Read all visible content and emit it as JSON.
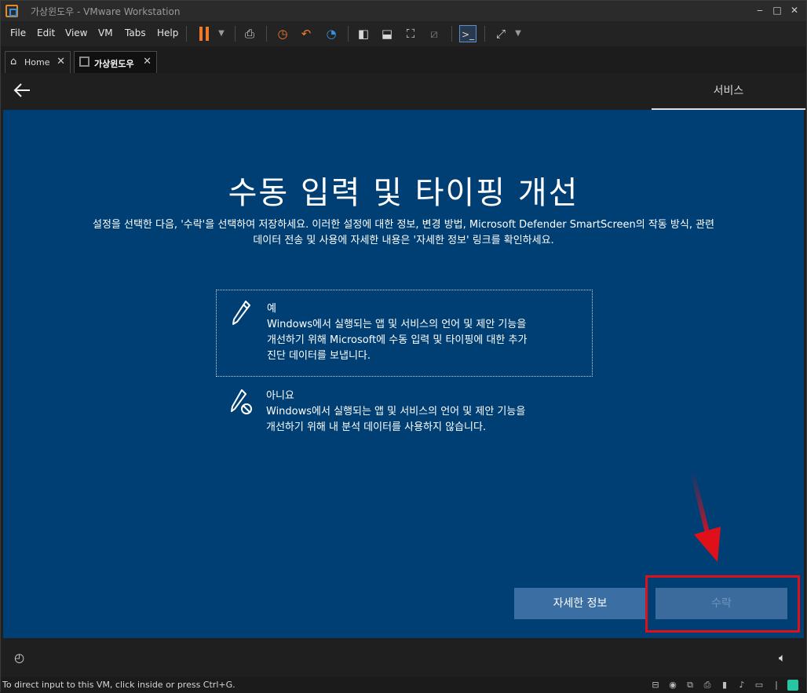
{
  "window": {
    "title": "가상윈도우 - VMware Workstation",
    "controls": [
      "‒",
      "□",
      "✕"
    ]
  },
  "menu": [
    "File",
    "Edit",
    "View",
    "VM",
    "Tabs",
    "Help"
  ],
  "tabs": [
    {
      "label": "Home",
      "active": false
    },
    {
      "label": "가상윈도우",
      "active": true
    }
  ],
  "oobe": {
    "section": "서비스",
    "heading": "수동 입력 및 타이핑 개선",
    "description_line1": "설정을 선택한 다음, '수락'을 선택하여 저장하세요. 이러한 설정에 대한 정보, 변경 방법, Microsoft Defender SmartScreen의 작동 방식, 관련",
    "description_line2": "데이터 전송 및 사용에 자세한 내용은 '자세한 정보' 링크를 확인하세요.",
    "options": [
      {
        "title": "예",
        "body_lines": [
          "Windows에서 실행되는 앱 및 서비스의 언어 및 제안 기능을",
          "개선하기 위해 Microsoft에 수동 입력 및 타이핑에 대한 추가",
          "진단 데이터를 보냅니다."
        ],
        "selected": true,
        "icon": "pen-icon"
      },
      {
        "title": "아니요",
        "body_lines": [
          "Windows에서 실행되는 앱 및 서비스의 언어 및 제안 기능을",
          "개선하기 위해 내 분석 데이터를 사용하지 않습니다."
        ],
        "selected": false,
        "icon": "pen-off-icon"
      }
    ],
    "buttons": {
      "learn_more": "자세한 정보",
      "accept": "수락"
    }
  },
  "statusbar": {
    "text": "To direct input to this VM, click inside or press Ctrl+G."
  },
  "colors": {
    "oobe_bg": "#003f74",
    "button": "#3b6fa3",
    "highlight": "#e0101a",
    "pause": "#f07a2a"
  }
}
